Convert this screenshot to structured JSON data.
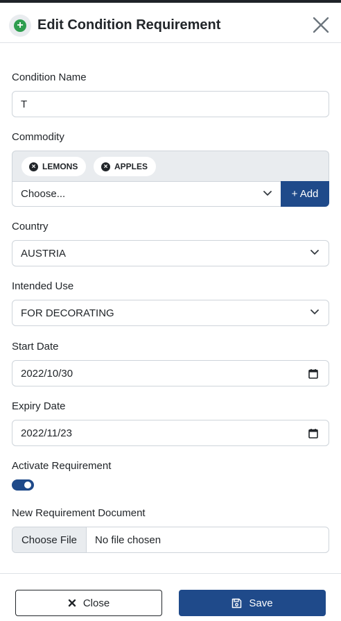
{
  "header": {
    "title": "Edit Condition Requirement",
    "icon": "plus-circle-icon",
    "close_icon": "close-icon"
  },
  "form": {
    "condition_name": {
      "label": "Condition Name",
      "value": "T"
    },
    "commodity": {
      "label": "Commodity",
      "tags": [
        "LEMONS",
        "APPLES"
      ],
      "select_value": "Choose...",
      "add_label": "+ Add"
    },
    "country": {
      "label": "Country",
      "value": "AUSTRIA"
    },
    "intended_use": {
      "label": "Intended Use",
      "value": "FOR DECORATING"
    },
    "start_date": {
      "label": "Start Date",
      "value": "2022/10/30"
    },
    "expiry_date": {
      "label": "Expiry Date",
      "value": "2022/11/23"
    },
    "activate": {
      "label": "Activate Requirement",
      "on": true
    },
    "document": {
      "label": "New Requirement Document",
      "button": "Choose File",
      "status": "No file chosen"
    }
  },
  "footer": {
    "close_label": "Close",
    "save_label": "Save"
  },
  "colors": {
    "primary": "#1f4a8a",
    "success": "#2e9e4f"
  }
}
